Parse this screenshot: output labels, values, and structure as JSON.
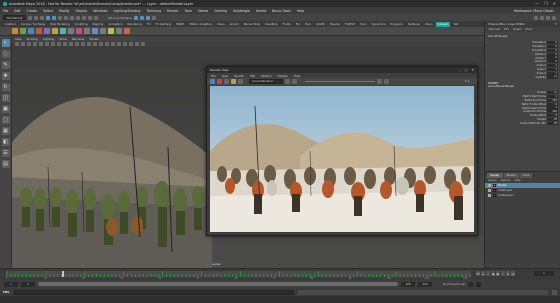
{
  "title_bar": {
    "title": "Autodesk Maya 2016 - Not for Resale: W:\\art\\Inside\\Scenes\\Camp\\Armies.ma* --- Layer : defaultRenderLayer",
    "controls": [
      "—",
      "❐",
      "✕"
    ]
  },
  "menu_bar": {
    "items": [
      "File",
      "Edit",
      "Create",
      "Select",
      "Modify",
      "Display",
      "Windows",
      "Lighting/Shading",
      "Texturing",
      "Render",
      "Toon",
      "Stereo",
      "Caching",
      "Solidangle",
      "Arnold",
      "Bonus Tools",
      "Help"
    ],
    "workspace_label": "Workspace: Maya Classic"
  },
  "status_line": {
    "mode": "Rendering",
    "live_surface": "No Live Surface"
  },
  "shelf": {
    "tabs": [
      "Custom",
      "Curves / Surfaces",
      "Poly Modeling",
      "Sculpting",
      "Rigging",
      "Animation",
      "Rendering",
      "FX",
      "FX Caching",
      "MASH",
      "Motion Graphics",
      "XGen",
      "Arnold",
      "Bonus Tools",
      "Deadline",
      "Fluids",
      "Fur",
      "Hair",
      "nCloth",
      "Muscle",
      "TURTLE",
      "Toon",
      "Dynamics",
      "Polygons",
      "Surfaces",
      "XGen",
      "Golaem",
      "Yeti"
    ],
    "active_tab": "Golaem"
  },
  "viewport": {
    "menu": [
      "View",
      "Shading",
      "Lighting",
      "Show",
      "Renderer",
      "Panels"
    ],
    "camera_label": "persp"
  },
  "render_view": {
    "title": "Render View",
    "menu": [
      "File",
      "View",
      "Render",
      "IPR",
      "Options",
      "Display",
      "Help"
    ],
    "renderer": "Arnold Renderer",
    "zoom": "1:1"
  },
  "right_panel": {
    "header": "Channel Box / Layer Editor",
    "tabs": [
      "Channels",
      "Edit",
      "Object",
      "Show"
    ],
    "object_name": "LanceFrenes3",
    "channels": [
      {
        "label": "Translate X",
        "value": "0"
      },
      {
        "label": "Translate Y",
        "value": "0"
      },
      {
        "label": "Translate Z",
        "value": "0"
      },
      {
        "label": "Rotate X",
        "value": "0"
      },
      {
        "label": "Rotate Y",
        "value": "0"
      },
      {
        "label": "Rotate Z",
        "value": "0"
      },
      {
        "label": "Scale X",
        "value": "1"
      },
      {
        "label": "Scale Y",
        "value": "1"
      },
      {
        "label": "Scale Z",
        "value": "1"
      },
      {
        "label": "Visibility",
        "value": "on"
      }
    ],
    "shapes_label": "SHAPES",
    "shape_name": "LanceFrenes3Shape",
    "shape_channels": [
      {
        "label": "Enable",
        "value": "on"
      },
      {
        "label": "Batch Start Frame",
        "value": "1"
      },
      {
        "label": "Batch End Frame",
        "value": "150"
      },
      {
        "label": "Batch Frame Offset",
        "value": "0"
      },
      {
        "label": "Output Start Frame",
        "value": "1"
      },
      {
        "label": "Output End Frame",
        "value": "100"
      },
      {
        "label": "Frame Offset",
        "value": "0"
      },
      {
        "label": "Output",
        "value": "off"
      },
      {
        "label": "Output Particles (PP)",
        "value": "off"
      }
    ],
    "layer_tabs": [
      "Display",
      "Render",
      "Anim"
    ],
    "layer_menu": [
      "Layers",
      "Options",
      "Help"
    ],
    "layers": [
      {
        "name": "Terrain",
        "selected": true
      },
      {
        "name": "LambLayer",
        "selected": false
      },
      {
        "name": "LambLayer1",
        "selected": false
      }
    ]
  },
  "time_slider": {
    "tick_labels": [
      "1",
      "10",
      "20",
      "30",
      "40",
      "50",
      "60",
      "70",
      "80",
      "90",
      "100",
      "110",
      "120"
    ],
    "current_frame": "1",
    "current_fraction": 0.12
  },
  "range_slider": {
    "start": "1",
    "end": "120",
    "range_start": "1",
    "range_end": "120",
    "char_set": "No Character Set"
  },
  "command_line": {
    "language": "MEL"
  }
}
